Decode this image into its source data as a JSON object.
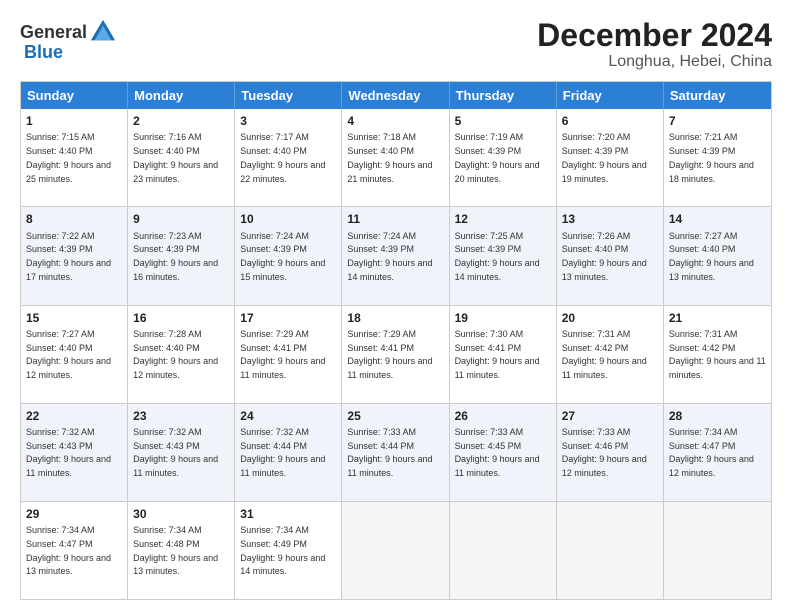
{
  "logo": {
    "general": "General",
    "blue": "Blue"
  },
  "title": "December 2024",
  "subtitle": "Longhua, Hebei, China",
  "days": [
    "Sunday",
    "Monday",
    "Tuesday",
    "Wednesday",
    "Thursday",
    "Friday",
    "Saturday"
  ],
  "weeks": [
    [
      {
        "day": 1,
        "sunrise": "7:15 AM",
        "sunset": "4:40 PM",
        "daylight": "9 hours and 25 minutes."
      },
      {
        "day": 2,
        "sunrise": "7:16 AM",
        "sunset": "4:40 PM",
        "daylight": "9 hours and 23 minutes."
      },
      {
        "day": 3,
        "sunrise": "7:17 AM",
        "sunset": "4:40 PM",
        "daylight": "9 hours and 22 minutes."
      },
      {
        "day": 4,
        "sunrise": "7:18 AM",
        "sunset": "4:40 PM",
        "daylight": "9 hours and 21 minutes."
      },
      {
        "day": 5,
        "sunrise": "7:19 AM",
        "sunset": "4:39 PM",
        "daylight": "9 hours and 20 minutes."
      },
      {
        "day": 6,
        "sunrise": "7:20 AM",
        "sunset": "4:39 PM",
        "daylight": "9 hours and 19 minutes."
      },
      {
        "day": 7,
        "sunrise": "7:21 AM",
        "sunset": "4:39 PM",
        "daylight": "9 hours and 18 minutes."
      }
    ],
    [
      {
        "day": 8,
        "sunrise": "7:22 AM",
        "sunset": "4:39 PM",
        "daylight": "9 hours and 17 minutes."
      },
      {
        "day": 9,
        "sunrise": "7:23 AM",
        "sunset": "4:39 PM",
        "daylight": "9 hours and 16 minutes."
      },
      {
        "day": 10,
        "sunrise": "7:24 AM",
        "sunset": "4:39 PM",
        "daylight": "9 hours and 15 minutes."
      },
      {
        "day": 11,
        "sunrise": "7:24 AM",
        "sunset": "4:39 PM",
        "daylight": "9 hours and 14 minutes."
      },
      {
        "day": 12,
        "sunrise": "7:25 AM",
        "sunset": "4:39 PM",
        "daylight": "9 hours and 14 minutes."
      },
      {
        "day": 13,
        "sunrise": "7:26 AM",
        "sunset": "4:40 PM",
        "daylight": "9 hours and 13 minutes."
      },
      {
        "day": 14,
        "sunrise": "7:27 AM",
        "sunset": "4:40 PM",
        "daylight": "9 hours and 13 minutes."
      }
    ],
    [
      {
        "day": 15,
        "sunrise": "7:27 AM",
        "sunset": "4:40 PM",
        "daylight": "9 hours and 12 minutes."
      },
      {
        "day": 16,
        "sunrise": "7:28 AM",
        "sunset": "4:40 PM",
        "daylight": "9 hours and 12 minutes."
      },
      {
        "day": 17,
        "sunrise": "7:29 AM",
        "sunset": "4:41 PM",
        "daylight": "9 hours and 11 minutes."
      },
      {
        "day": 18,
        "sunrise": "7:29 AM",
        "sunset": "4:41 PM",
        "daylight": "9 hours and 11 minutes."
      },
      {
        "day": 19,
        "sunrise": "7:30 AM",
        "sunset": "4:41 PM",
        "daylight": "9 hours and 11 minutes."
      },
      {
        "day": 20,
        "sunrise": "7:31 AM",
        "sunset": "4:42 PM",
        "daylight": "9 hours and 11 minutes."
      },
      {
        "day": 21,
        "sunrise": "7:31 AM",
        "sunset": "4:42 PM",
        "daylight": "9 hours and 11 minutes."
      }
    ],
    [
      {
        "day": 22,
        "sunrise": "7:32 AM",
        "sunset": "4:43 PM",
        "daylight": "9 hours and 11 minutes."
      },
      {
        "day": 23,
        "sunrise": "7:32 AM",
        "sunset": "4:43 PM",
        "daylight": "9 hours and 11 minutes."
      },
      {
        "day": 24,
        "sunrise": "7:32 AM",
        "sunset": "4:44 PM",
        "daylight": "9 hours and 11 minutes."
      },
      {
        "day": 25,
        "sunrise": "7:33 AM",
        "sunset": "4:44 PM",
        "daylight": "9 hours and 11 minutes."
      },
      {
        "day": 26,
        "sunrise": "7:33 AM",
        "sunset": "4:45 PM",
        "daylight": "9 hours and 11 minutes."
      },
      {
        "day": 27,
        "sunrise": "7:33 AM",
        "sunset": "4:46 PM",
        "daylight": "9 hours and 12 minutes."
      },
      {
        "day": 28,
        "sunrise": "7:34 AM",
        "sunset": "4:47 PM",
        "daylight": "9 hours and 12 minutes."
      }
    ],
    [
      {
        "day": 29,
        "sunrise": "7:34 AM",
        "sunset": "4:47 PM",
        "daylight": "9 hours and 13 minutes."
      },
      {
        "day": 30,
        "sunrise": "7:34 AM",
        "sunset": "4:48 PM",
        "daylight": "9 hours and 13 minutes."
      },
      {
        "day": 31,
        "sunrise": "7:34 AM",
        "sunset": "4:49 PM",
        "daylight": "9 hours and 14 minutes."
      },
      null,
      null,
      null,
      null
    ]
  ]
}
